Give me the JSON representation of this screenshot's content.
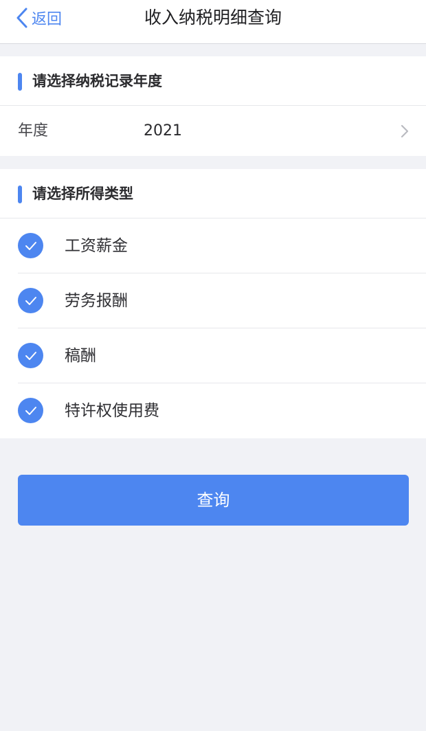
{
  "nav": {
    "back_label": "返回",
    "title": "收入纳税明细查询"
  },
  "year_section": {
    "title": "请选择纳税记录年度",
    "row_label": "年度",
    "value": "2021"
  },
  "type_section": {
    "title": "请选择所得类型",
    "options": [
      {
        "label": "工资薪金",
        "checked": true
      },
      {
        "label": "劳务报酬",
        "checked": true
      },
      {
        "label": "稿酬",
        "checked": true
      },
      {
        "label": "特许权使用费",
        "checked": true
      }
    ]
  },
  "query_button": {
    "label": "查询"
  },
  "colors": {
    "accent": "#4d86f0",
    "background": "#f1f2f6",
    "card": "#ffffff"
  }
}
